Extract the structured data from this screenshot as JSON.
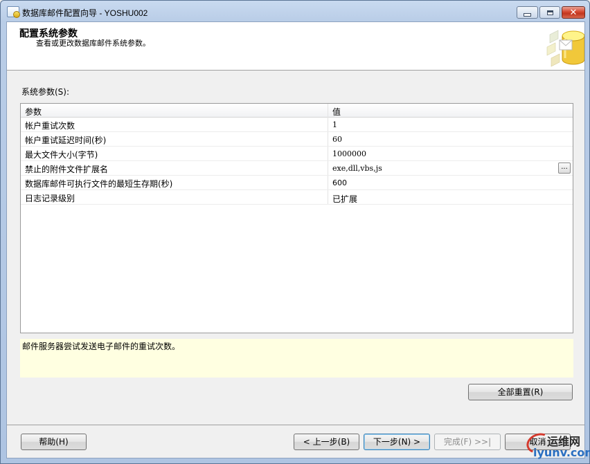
{
  "window": {
    "title": "数据库邮件配置向导 - YOSHU002",
    "close_glyph": "✕"
  },
  "header": {
    "title": "配置系统参数",
    "subtitle": "查看或更改数据库邮件系统参数。"
  },
  "section_label": "系统参数(S):",
  "grid": {
    "columns": [
      "参数",
      "值"
    ],
    "rows": [
      {
        "name": "帐户重试次数",
        "value": "1"
      },
      {
        "name": "帐户重试延迟时间(秒)",
        "value": "60"
      },
      {
        "name": "最大文件大小(字节)",
        "value": "1000000"
      },
      {
        "name": "禁止的附件文件扩展名",
        "value": "exe,dll,vbs,js",
        "has_button": true,
        "button_label": "..."
      },
      {
        "name": "数据库邮件可执行文件的最短生存期(秒)",
        "value": "600"
      },
      {
        "name": "日志记录级别",
        "value": "已扩展"
      }
    ]
  },
  "description": "邮件服务器尝试发送电子邮件的重试次数。",
  "buttons": {
    "reset_all": "全部重置(R)",
    "help": "帮助(H)",
    "back": "< 上一步(B)",
    "next": "下一步(N) >",
    "finish": "完成(F) >>|",
    "cancel": "取消"
  },
  "watermark": {
    "cn": "运维网",
    "en": "iyunv.com"
  },
  "colors": {
    "description_bg": "#ffffe1",
    "title_bar": "#b9cde7",
    "close_button": "#c0361f",
    "watermark_blue": "#2a6fc1",
    "watermark_red": "#d43a2e"
  }
}
